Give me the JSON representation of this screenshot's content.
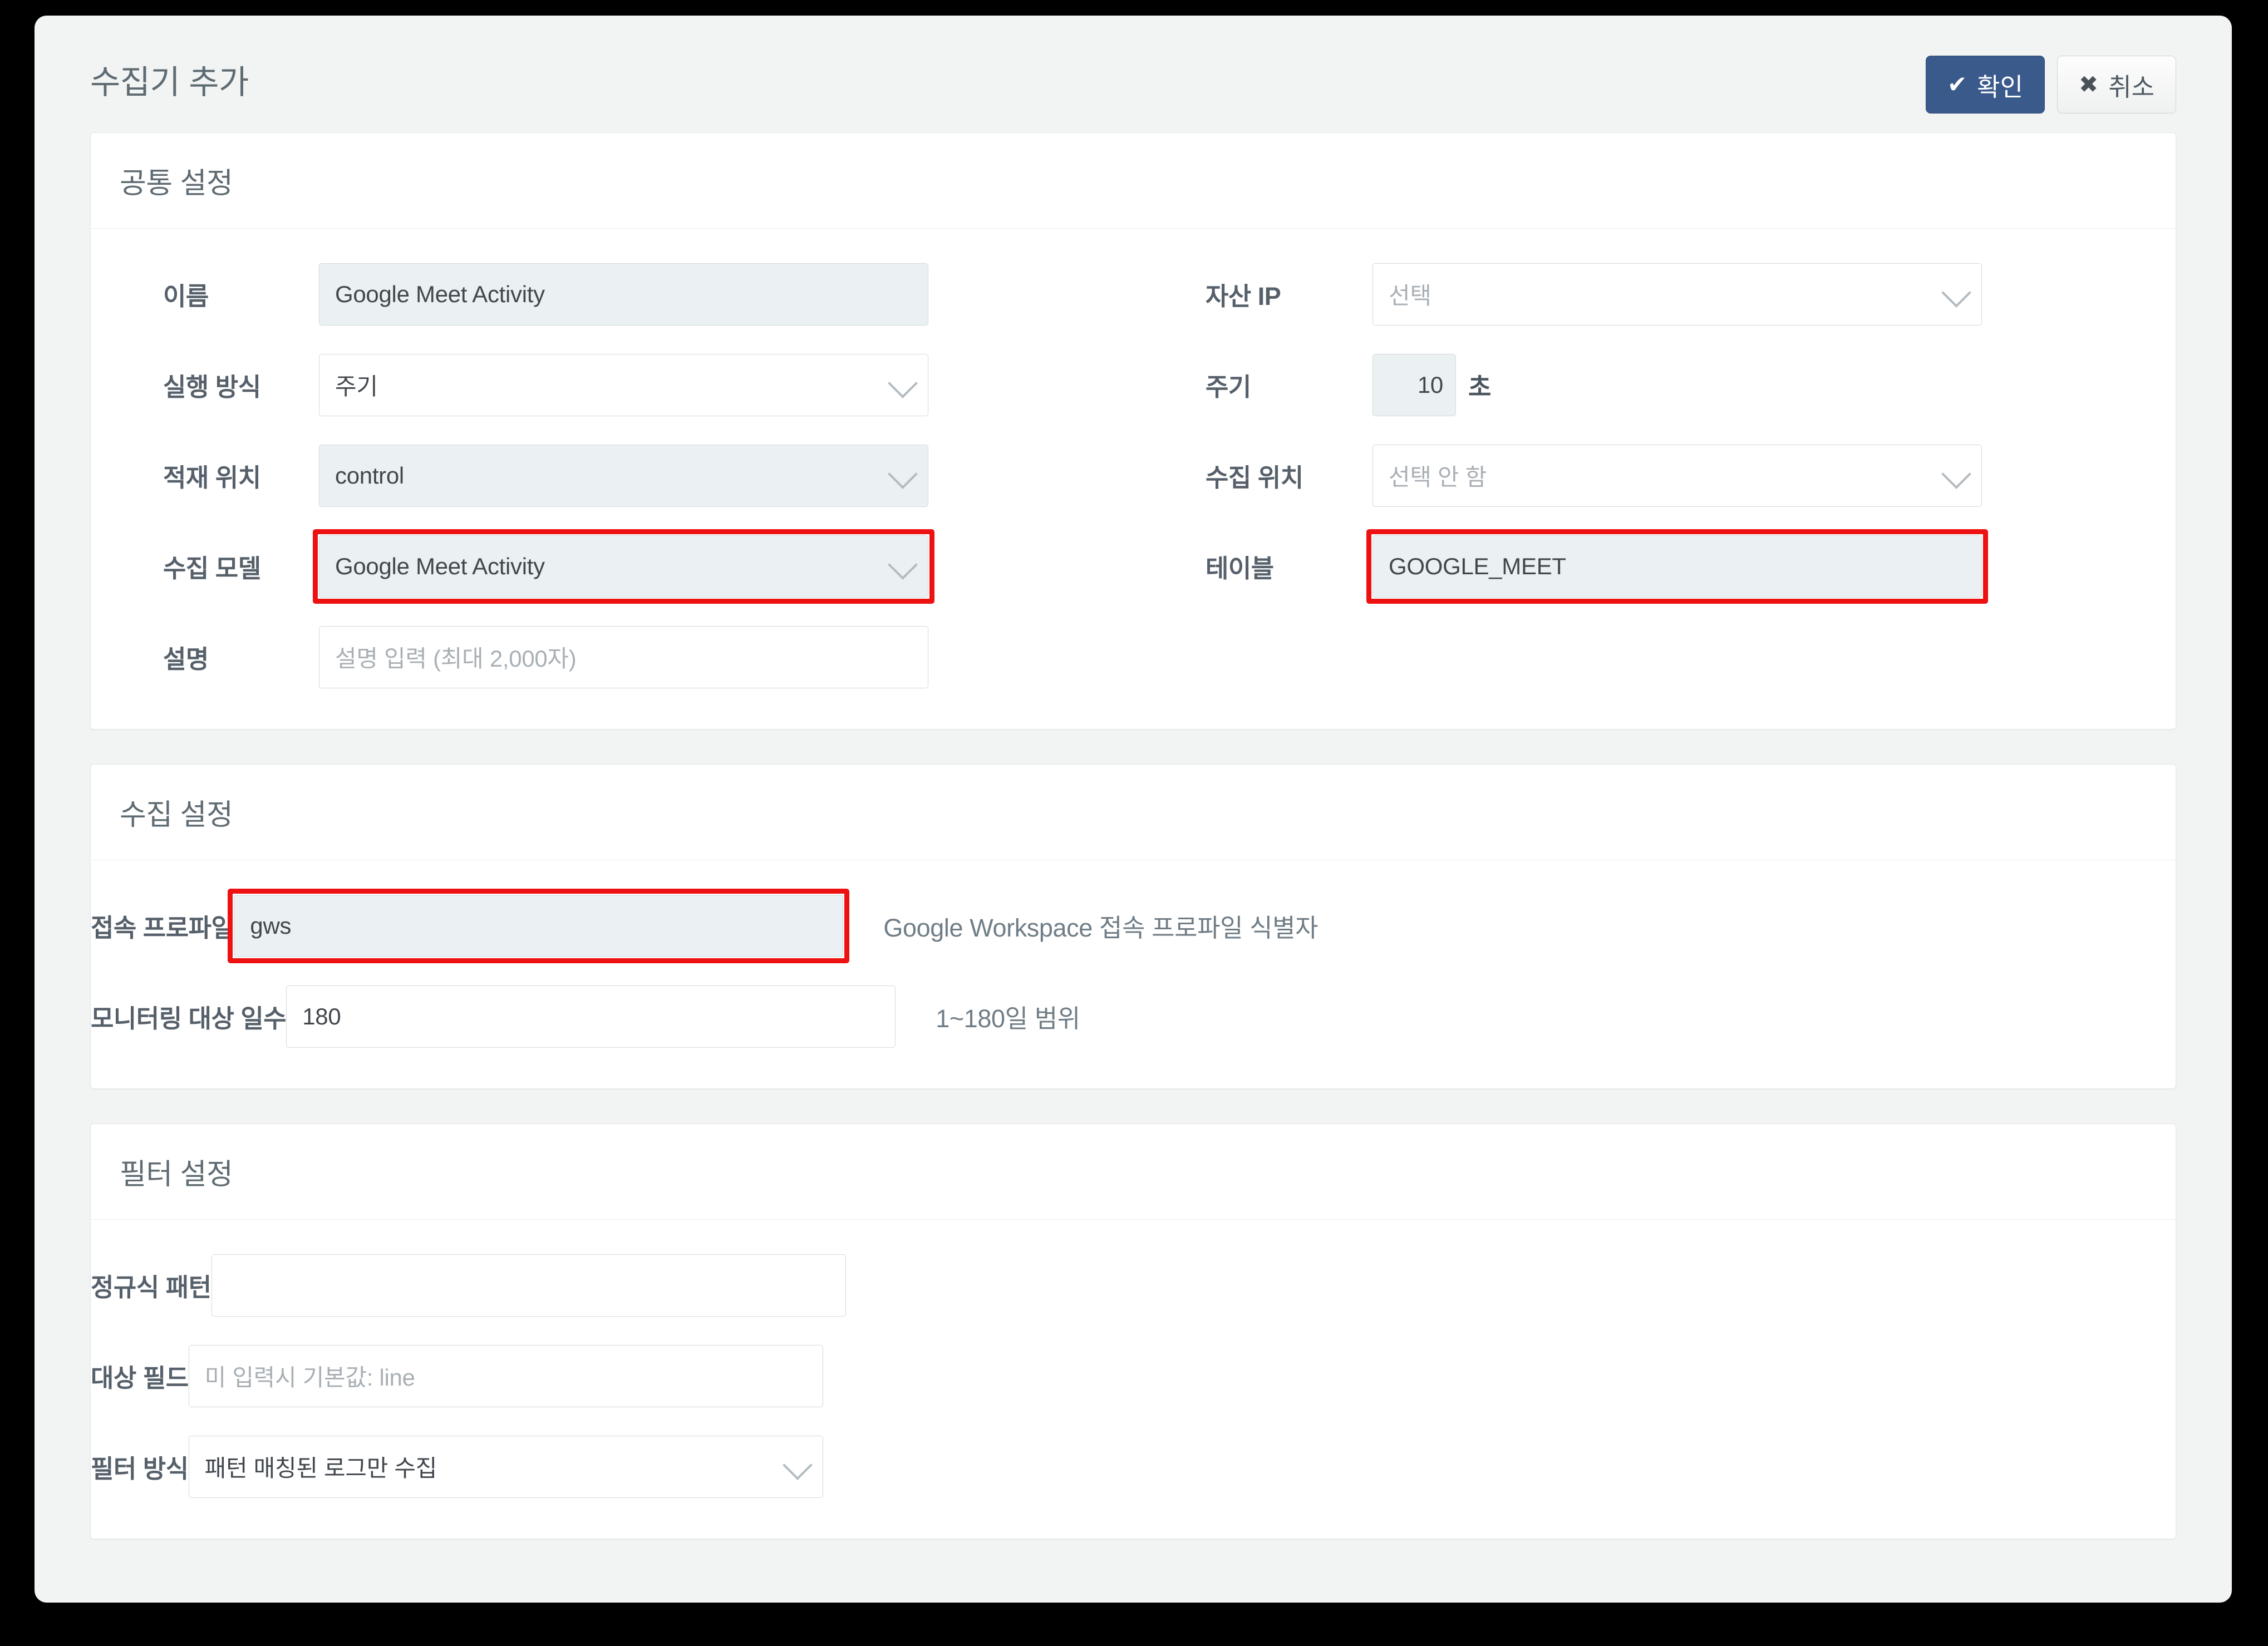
{
  "window": {
    "title": "수집기 추가"
  },
  "header": {
    "confirm_label": "확인",
    "confirm_glyph": "✔",
    "cancel_label": "취소",
    "cancel_glyph": "✖"
  },
  "colors": {
    "primary_button": "#3a5a8c",
    "highlight": "#ee1111",
    "filled_input": "#ebf1f2",
    "modal_background": "#f2f4f4"
  },
  "sections": {
    "common": {
      "title": "공통 설정",
      "fields": {
        "name": {
          "label": "이름",
          "value": "Google Meet Activity"
        },
        "run_mode": {
          "label": "실행 방식",
          "value": "주기"
        },
        "load_location": {
          "label": "적재 위치",
          "value": "control"
        },
        "collect_model": {
          "label": "수집 모델",
          "value": "Google Meet Activity"
        },
        "description": {
          "label": "설명",
          "placeholder": "설명 입력 (최대 2,000자)",
          "value": ""
        },
        "asset_ip": {
          "label": "자산 IP",
          "placeholder": "선택",
          "value": ""
        },
        "interval": {
          "label": "주기",
          "value": "10",
          "unit": "초"
        },
        "collect_location": {
          "label": "수집 위치",
          "placeholder": "선택 안 함",
          "value": ""
        },
        "table": {
          "label": "테이블",
          "value": "GOOGLE_MEET"
        }
      }
    },
    "collection": {
      "title": "수집 설정",
      "fields": {
        "profile": {
          "label": "접속 프로파일",
          "value": "gws",
          "helper": "Google Workspace 접속 프로파일 식별자"
        },
        "monitor_days": {
          "label": "모니터링 대상 일수",
          "value": "180",
          "helper": "1~180일 범위"
        }
      }
    },
    "filter": {
      "title": "필터 설정",
      "fields": {
        "regex_pattern": {
          "label": "정규식 패턴",
          "value": "",
          "placeholder": ""
        },
        "target_field": {
          "label": "대상 필드",
          "value": "",
          "placeholder": "미 입력시 기본값: line"
        },
        "filter_mode": {
          "label": "필터 방식",
          "value": "패턴 매칭된 로그만 수집"
        }
      }
    }
  }
}
